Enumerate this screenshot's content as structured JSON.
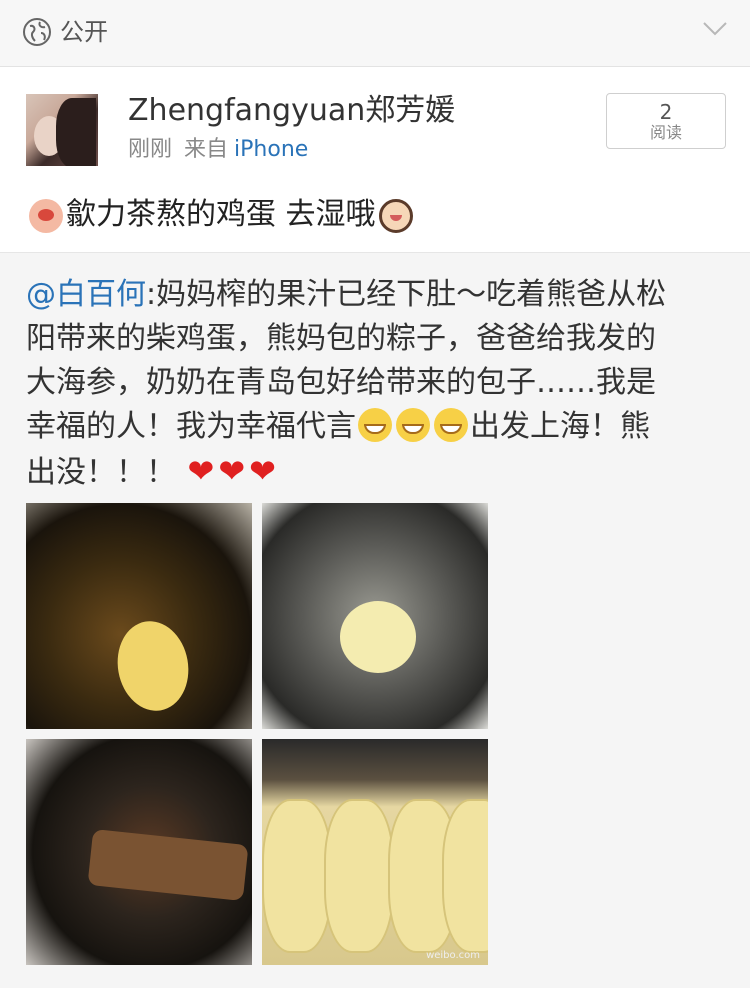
{
  "header": {
    "visibility_label": "公开",
    "icons": {
      "visibility": "globe-icon",
      "expand": "chevron-down-icon"
    }
  },
  "post": {
    "username": "Zhengfangyuan郑芳媛",
    "time": "刚刚",
    "from_label": "来自",
    "source": "iPhone",
    "reads": {
      "count": "2",
      "label": "阅读"
    },
    "text": "歙力茶熬的鸡蛋 去湿哦",
    "emoji": [
      "hen-emoji",
      "girl-emoji"
    ]
  },
  "repost": {
    "mention": "@白百何",
    "text_line1": ":妈妈榨的果汁已经下肚～吃着熊爸从松",
    "text_line2": "阳带来的柴鸡蛋，熊妈包的粽子，爸爸给我发的",
    "text_line3": "大海参，奶奶在青岛包好给带来的包子……我是",
    "text_line4a": "幸福的人！我为幸福代言",
    "text_line4b": "出发上海！熊",
    "text_line5": "出没！！！",
    "hearts": [
      "❤",
      "❤",
      "❤"
    ],
    "photos": [
      "zongzi-photo",
      "egg-photo",
      "sea-cucumber-photo",
      "buns-photo"
    ],
    "watermark": "weibo.com"
  },
  "colors": {
    "link": "#2a73b8",
    "heart": "#e02020",
    "header_bg": "#f7f7f7",
    "repost_bg": "#f5f5f5"
  }
}
